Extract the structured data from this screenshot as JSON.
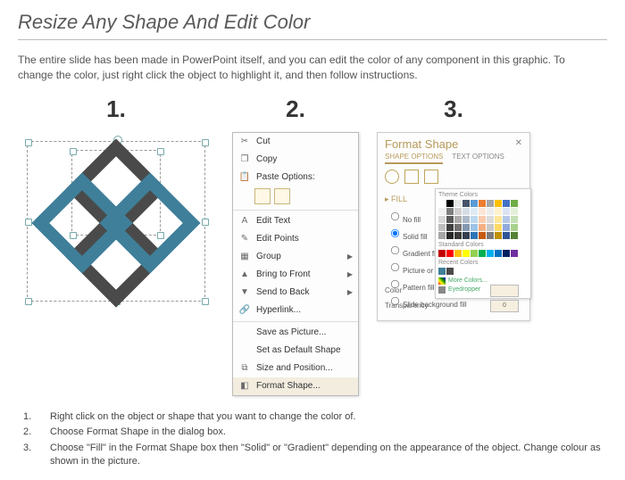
{
  "title": "Resize Any Shape And Edit Color",
  "intro": "The entire slide has been made in PowerPoint itself, and you can edit the color of any component in this graphic. To change the color, just right click the object to highlight it, and then follow instructions.",
  "steps": {
    "s1": "1.",
    "s2": "2.",
    "s3": "3."
  },
  "menu": {
    "cut": "Cut",
    "copy": "Copy",
    "paste": "Paste Options:",
    "edit_text": "Edit Text",
    "edit_points": "Edit Points",
    "group": "Group",
    "bring_front": "Bring to Front",
    "send_back": "Send to Back",
    "hyperlink": "Hyperlink...",
    "save_pic": "Save as Picture...",
    "set_default": "Set as Default Shape",
    "size_pos": "Size and Position...",
    "format_shape": "Format Shape..."
  },
  "panel": {
    "title": "Format Shape",
    "tab1": "SHAPE OPTIONS",
    "tab2": "TEXT OPTIONS",
    "section": "FILL",
    "r_nofill": "No fill",
    "r_solid": "Solid fill",
    "r_gradient": "Gradient fill",
    "r_picture": "Picture or texture fill",
    "r_pattern": "Pattern fill",
    "r_slide": "Slide background fill",
    "theme_colors": "Theme Colors",
    "standard_colors": "Standard Colors",
    "recent_colors": "Recent Colors",
    "more_colors": "More Colors...",
    "eyedropper": "Eyedropper",
    "color": "Color",
    "transparency": "Transparency",
    "trans_val": "0"
  },
  "list": {
    "n1": "1.",
    "n2": "2.",
    "n3": "3.",
    "t1": "Right click on the object or shape that you want to change the color of.",
    "t2": "Choose Format Shape in the dialog box.",
    "t3": "Choose \"Fill\" in the Format Shape box then \"Solid\" or \"Gradient\" depending on the appearance of the object. Change colour as shown in the picture."
  }
}
